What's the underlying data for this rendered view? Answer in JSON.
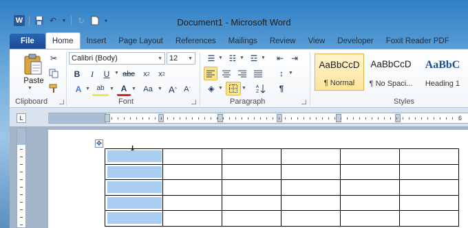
{
  "window": {
    "title": "Document1  -  Microsoft Word"
  },
  "quick_access": {
    "app_icon": "W",
    "icons": [
      "word-logo-icon",
      "save-icon",
      "undo-icon",
      "redo-icon",
      "new-document-icon",
      "customize-dropdown-icon"
    ]
  },
  "tabs": [
    {
      "label": "File"
    },
    {
      "label": "Home"
    },
    {
      "label": "Insert"
    },
    {
      "label": "Page Layout"
    },
    {
      "label": "References"
    },
    {
      "label": "Mailings"
    },
    {
      "label": "Review"
    },
    {
      "label": "View"
    },
    {
      "label": "Developer"
    },
    {
      "label": "Foxit Reader PDF"
    }
  ],
  "ribbon": {
    "clipboard": {
      "label": "Clipboard",
      "paste_label": "Paste"
    },
    "font": {
      "label": "Font",
      "font_name": "Calibri (Body)",
      "font_size": "12"
    },
    "paragraph": {
      "label": "Paragraph"
    },
    "styles": {
      "label": "Styles",
      "items": [
        {
          "sample": "AaBbCcD",
          "name": "¶ Normal",
          "selected": true
        },
        {
          "sample": "AaBbCcD",
          "name": "¶ No Spaci..."
        },
        {
          "sample": "AaBbC",
          "name": "Heading 1"
        }
      ]
    }
  },
  "ruler": {
    "tab_selector": "L",
    "end_number": "6"
  },
  "document": {
    "table": {
      "rows": 5,
      "columns": 6,
      "selected_column": 1
    }
  },
  "colors": {
    "file_tab": "#2a63b8",
    "selection": "#a9cdf0",
    "active_button": "#ffe38a"
  }
}
